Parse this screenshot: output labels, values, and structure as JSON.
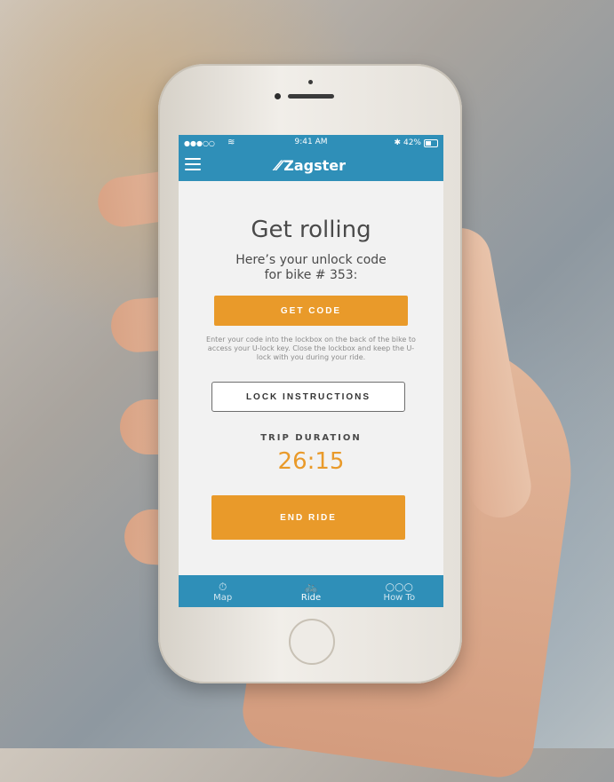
{
  "status_bar": {
    "signal": "●●●○○",
    "time": "9:41 AM",
    "bluetooth": "✱",
    "battery_percent": "42%",
    "battery_level": 0.42
  },
  "header": {
    "logo_mark": "⁄⁄",
    "brand": "Zagster"
  },
  "main": {
    "title": "Get rolling",
    "subtitle_line1": "Here’s your unlock code",
    "subtitle_line2": "for bike # 353:",
    "get_code_label": "GET CODE",
    "help_text": "Enter your code into the lockbox on the back of the bike to access your U-lock key. Close the lockbox and keep the U-lock with you during your ride.",
    "lock_instructions_label": "LOCK INSTRUCTIONS",
    "trip_duration_label": "TRIP DURATION",
    "trip_duration_value": "26:15",
    "end_ride_label": "END RIDE"
  },
  "tabs": [
    {
      "label": "Map",
      "icon": "stopwatch-icon",
      "glyph": "⏱"
    },
    {
      "label": "Ride",
      "icon": "bicycle-icon",
      "glyph": "🚲"
    },
    {
      "label": "How To",
      "icon": "dots-icon",
      "glyph": "○○○"
    }
  ],
  "colors": {
    "primary_blue": "#2f8fb8",
    "accent_orange": "#e99a2a"
  }
}
